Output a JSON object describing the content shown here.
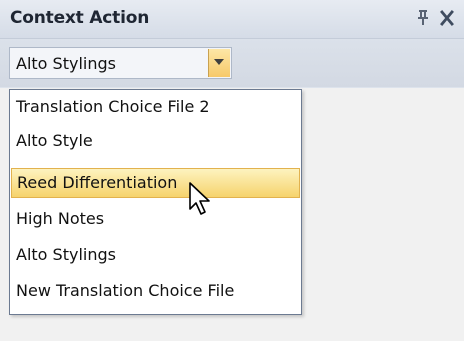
{
  "panel": {
    "title": "Context Action",
    "pin_icon": "pin-icon",
    "close_icon": "close-icon"
  },
  "toolbar": {
    "combo_value": "Alto Stylings",
    "dropdown_icon": "chevron-down-icon"
  },
  "dropdown": {
    "items": [
      "Translation Choice File 2",
      "Alto Style",
      "Reed Differentiation",
      "High Notes",
      "Alto Stylings",
      "New Translation Choice File"
    ],
    "selected_index": 2
  },
  "colors": {
    "highlight": "#f6d36d",
    "titlebar": "#dde3ec",
    "dropdown_button": "#f7c96a"
  }
}
